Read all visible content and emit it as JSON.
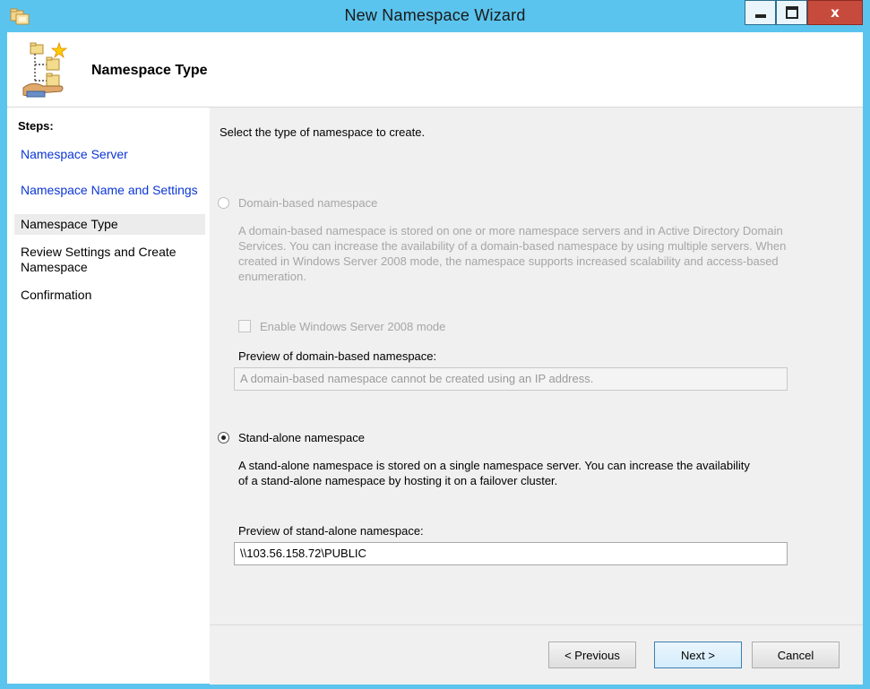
{
  "window": {
    "title": "New Namespace Wizard",
    "close_glyph": "x"
  },
  "header": {
    "title": "Namespace Type",
    "icon": "namespace-wizard-icon"
  },
  "steps": {
    "label": "Steps:",
    "items": [
      {
        "label": "Namespace Server",
        "state": "completed"
      },
      {
        "label": "Namespace Name and Settings",
        "state": "completed"
      },
      {
        "label": "Namespace Type",
        "state": "current"
      },
      {
        "label": "Review Settings and Create Namespace",
        "state": "pending"
      },
      {
        "label": "Confirmation",
        "state": "pending"
      }
    ]
  },
  "main": {
    "prompt": "Select the type of namespace to create.",
    "domain": {
      "label": "Domain-based namespace",
      "selected": false,
      "enabled": false,
      "description": "A domain-based namespace is stored on one or more namespace servers and in Active Directory Domain Services. You can increase the availability of a domain-based namespace by using multiple servers. When created in Windows Server 2008 mode, the namespace supports increased scalability and access-based enumeration.",
      "checkbox_label": "Enable Windows Server 2008 mode",
      "checkbox_checked": false,
      "preview_label": "Preview of domain-based namespace:",
      "preview_value": "A domain-based namespace cannot be created using an IP address."
    },
    "standalone": {
      "label": "Stand-alone namespace",
      "selected": true,
      "enabled": true,
      "description": "A stand-alone namespace is stored on a single namespace server. You can increase the availability of a stand-alone namespace by hosting it on a failover cluster.",
      "preview_label": "Preview of stand-alone namespace:",
      "preview_value": "\\\\103.56.158.72\\PUBLIC"
    }
  },
  "footer": {
    "previous_label": "< Previous",
    "next_label": "Next >",
    "cancel_label": "Cancel"
  },
  "colors": {
    "frame": "#5bc4ee",
    "link": "#0b36d6",
    "close_button": "#c74b3d",
    "panel_bg": "#f0f0f0"
  }
}
